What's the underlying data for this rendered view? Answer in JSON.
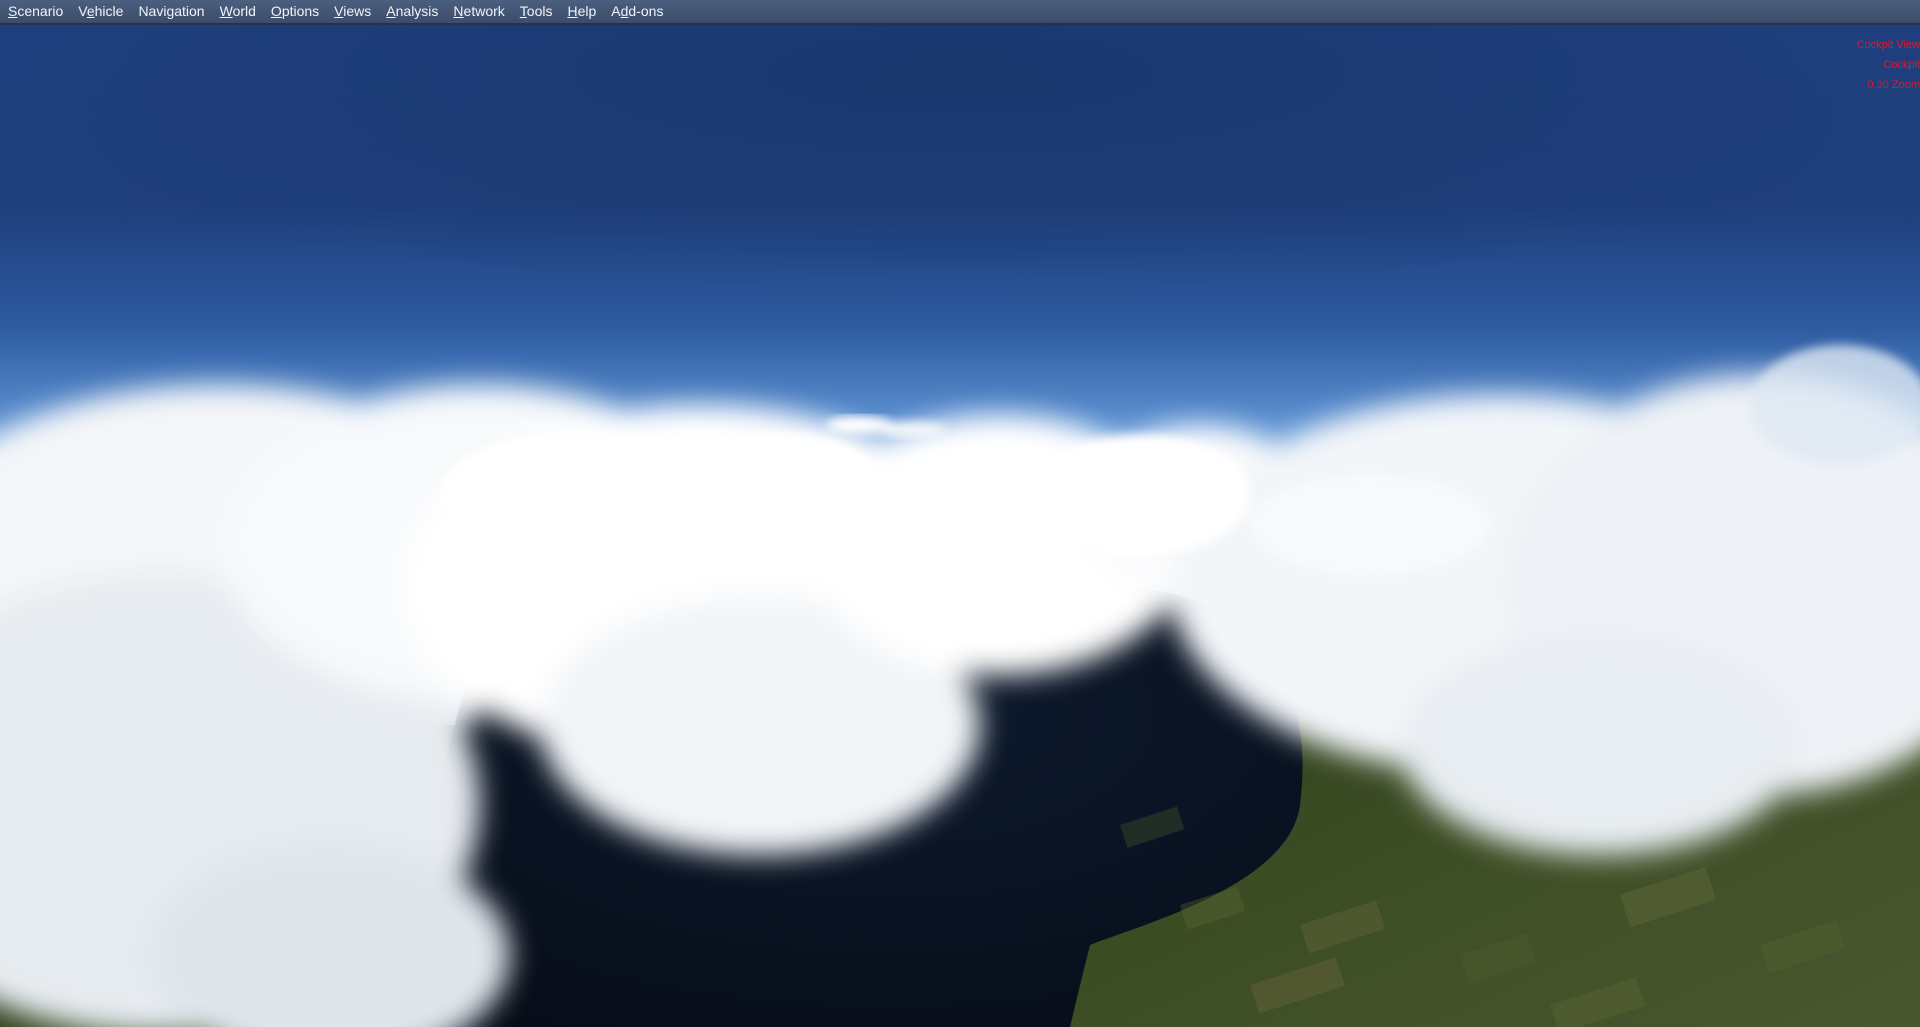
{
  "menubar": {
    "items": [
      {
        "pre": "",
        "mnemonic": "S",
        "post": "cenario"
      },
      {
        "pre": "V",
        "mnemonic": "e",
        "post": "hicle"
      },
      {
        "pre": "Navigation",
        "mnemonic": "",
        "post": ""
      },
      {
        "pre": "",
        "mnemonic": "W",
        "post": "orld"
      },
      {
        "pre": "",
        "mnemonic": "O",
        "post": "ptions"
      },
      {
        "pre": "",
        "mnemonic": "V",
        "post": "iews"
      },
      {
        "pre": "",
        "mnemonic": "A",
        "post": "nalysis"
      },
      {
        "pre": "",
        "mnemonic": "N",
        "post": "etwork"
      },
      {
        "pre": "",
        "mnemonic": "T",
        "post": "ools"
      },
      {
        "pre": "",
        "mnemonic": "H",
        "post": "elp"
      },
      {
        "pre": "A",
        "mnemonic": "d",
        "post": "d-ons"
      }
    ]
  },
  "view_info": {
    "line1": "Cockpit View",
    "line2": "Cockpit",
    "line3": "0.30 Zoom"
  },
  "colors": {
    "menu_text": "#f2f4f8",
    "overlay_text": "#e0182c",
    "sky_top": "#1f3f80",
    "sky_horizon": "#6fa3dc",
    "water": "#0b1424",
    "land": "#3a4a22"
  }
}
